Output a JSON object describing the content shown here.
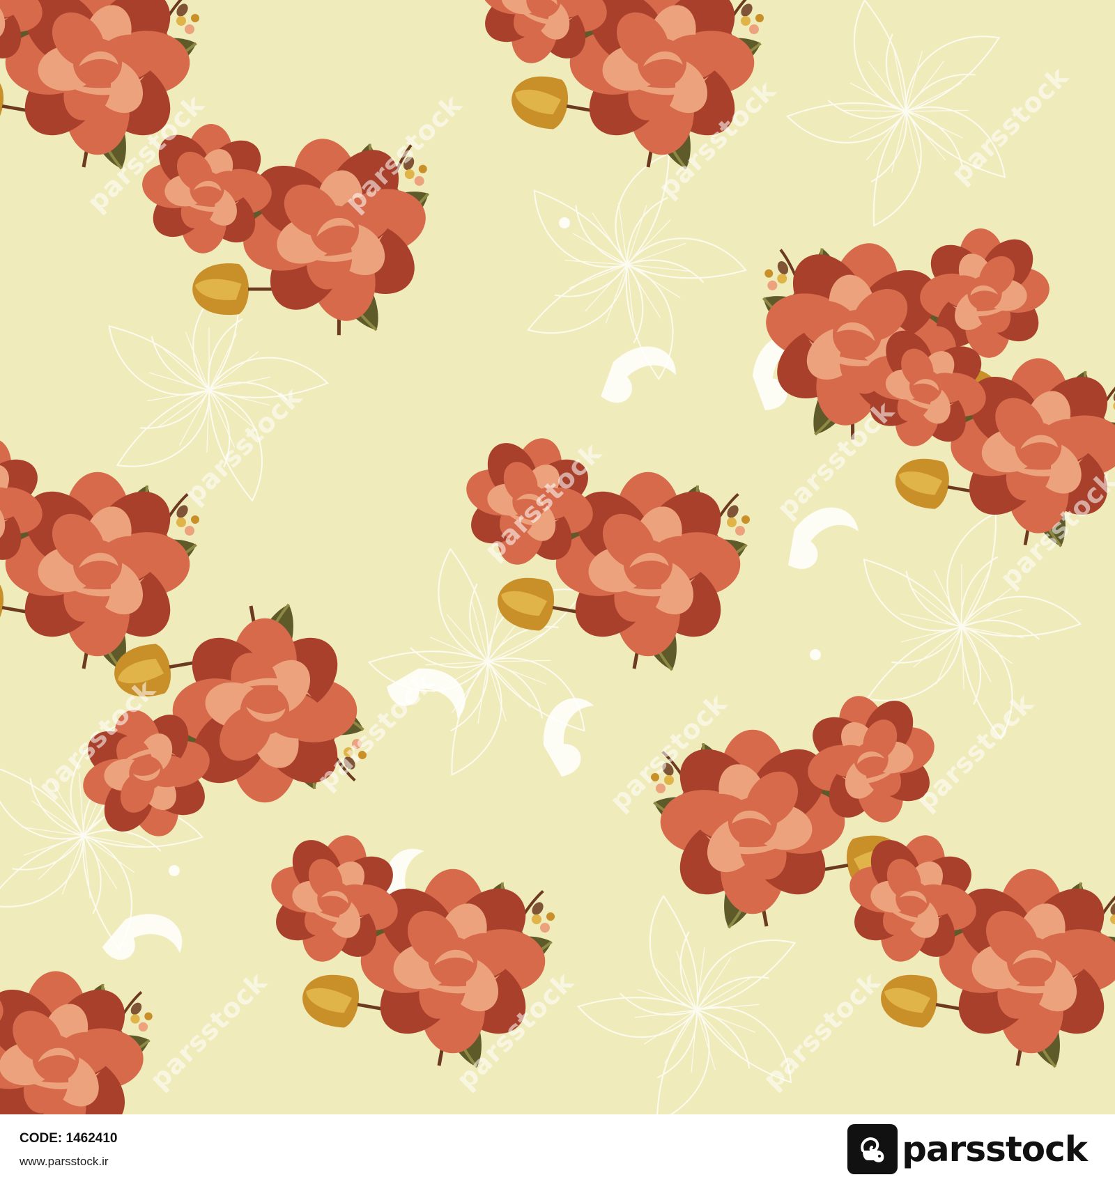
{
  "image": {
    "subject": "Seamless vintage floral pattern of coral roses and ochre tulips with olive leaves on a pale yellow background with white line-art flowers",
    "background_color": "#f0ebba",
    "palette": {
      "rose_dark": "#a8402c",
      "rose_mid": "#d66a4a",
      "rose_light": "#eca27c",
      "tulip": "#c9902a",
      "tulip_light": "#e0b448",
      "leaf_dark": "#5e5a2a",
      "leaf_light": "#8e8a44",
      "stem": "#6b3a20",
      "lineart": "#ffffff"
    }
  },
  "watermark": {
    "text": "parsstock"
  },
  "footer": {
    "code_label": "CODE:",
    "code_value": "1462410",
    "site": "www.parsstock.ir",
    "brand": "parsstock",
    "brand_icon": "ram-logo-icon"
  }
}
